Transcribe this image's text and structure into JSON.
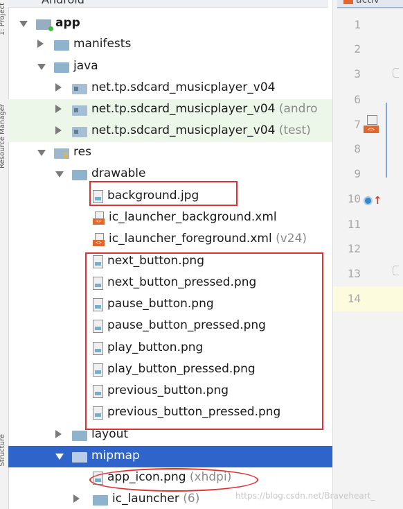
{
  "panel_header": {
    "title": "Android"
  },
  "side_tabs": [
    "1: Project",
    "Resource Manager",
    "Structure"
  ],
  "tree": [
    {
      "label": "app",
      "bold": true,
      "suffix": "",
      "arrow": "down",
      "icon": "app",
      "level": 0
    },
    {
      "label": "manifests",
      "suffix": "",
      "arrow": "right",
      "icon": "folder",
      "level": 1
    },
    {
      "label": "java",
      "suffix": "",
      "arrow": "down",
      "icon": "folder",
      "level": 1
    },
    {
      "label": "net.tp.sdcard_musicplayer_v04",
      "suffix": "",
      "arrow": "right",
      "icon": "pkg",
      "level": 2
    },
    {
      "label": "net.tp.sdcard_musicplayer_v04",
      "suffix": " (andro",
      "arrow": "right",
      "icon": "pkg",
      "level": 2,
      "green": true
    },
    {
      "label": "net.tp.sdcard_musicplayer_v04",
      "suffix": " (test)",
      "arrow": "right",
      "icon": "pkg",
      "level": 2,
      "green": true
    },
    {
      "label": "res",
      "suffix": "",
      "arrow": "down",
      "icon": "res",
      "level": 1
    },
    {
      "label": "drawable",
      "suffix": "",
      "arrow": "down",
      "icon": "folder",
      "level": 2
    },
    {
      "label": "background.jpg",
      "suffix": "",
      "arrow": "",
      "icon": "image",
      "level": 3
    },
    {
      "label": "ic_launcher_background.xml",
      "suffix": "",
      "arrow": "",
      "icon": "xml",
      "level": 3
    },
    {
      "label": "ic_launcher_foreground.xml",
      "suffix": " (v24)",
      "arrow": "",
      "icon": "xml",
      "level": 3
    },
    {
      "label": "next_button.png",
      "suffix": "",
      "arrow": "",
      "icon": "image",
      "level": 3
    },
    {
      "label": "next_button_pressed.png",
      "suffix": "",
      "arrow": "",
      "icon": "image",
      "level": 3
    },
    {
      "label": "pause_button.png",
      "suffix": "",
      "arrow": "",
      "icon": "image",
      "level": 3
    },
    {
      "label": "pause_button_pressed.png",
      "suffix": "",
      "arrow": "",
      "icon": "image",
      "level": 3
    },
    {
      "label": "play_button.png",
      "suffix": "",
      "arrow": "",
      "icon": "image",
      "level": 3
    },
    {
      "label": "play_button_pressed.png",
      "suffix": "",
      "arrow": "",
      "icon": "image",
      "level": 3
    },
    {
      "label": "previous_button.png",
      "suffix": "",
      "arrow": "",
      "icon": "image",
      "level": 3
    },
    {
      "label": "previous_button_pressed.png",
      "suffix": "",
      "arrow": "",
      "icon": "image",
      "level": 3
    },
    {
      "label": "layout",
      "suffix": "",
      "arrow": "right",
      "icon": "folder",
      "level": 2
    },
    {
      "label": "mipmap",
      "suffix": "",
      "arrow": "down",
      "icon": "folder",
      "level": 2,
      "selected": true
    },
    {
      "label": "app_icon.png",
      "suffix": " (xhdpi)",
      "arrow": "",
      "icon": "image",
      "level": 3
    },
    {
      "label": "ic_launcher",
      "suffix": " (6)",
      "arrow": "right",
      "icon": "folder",
      "level": 3
    }
  ],
  "editor": {
    "tab_label": "activ",
    "line_numbers": [
      "1",
      "2",
      "3",
      "6",
      "7",
      "8",
      "9",
      "10",
      "11",
      "12",
      "13",
      "14"
    ]
  },
  "watermark": "https://blog.csdn.net/Braveheart_"
}
